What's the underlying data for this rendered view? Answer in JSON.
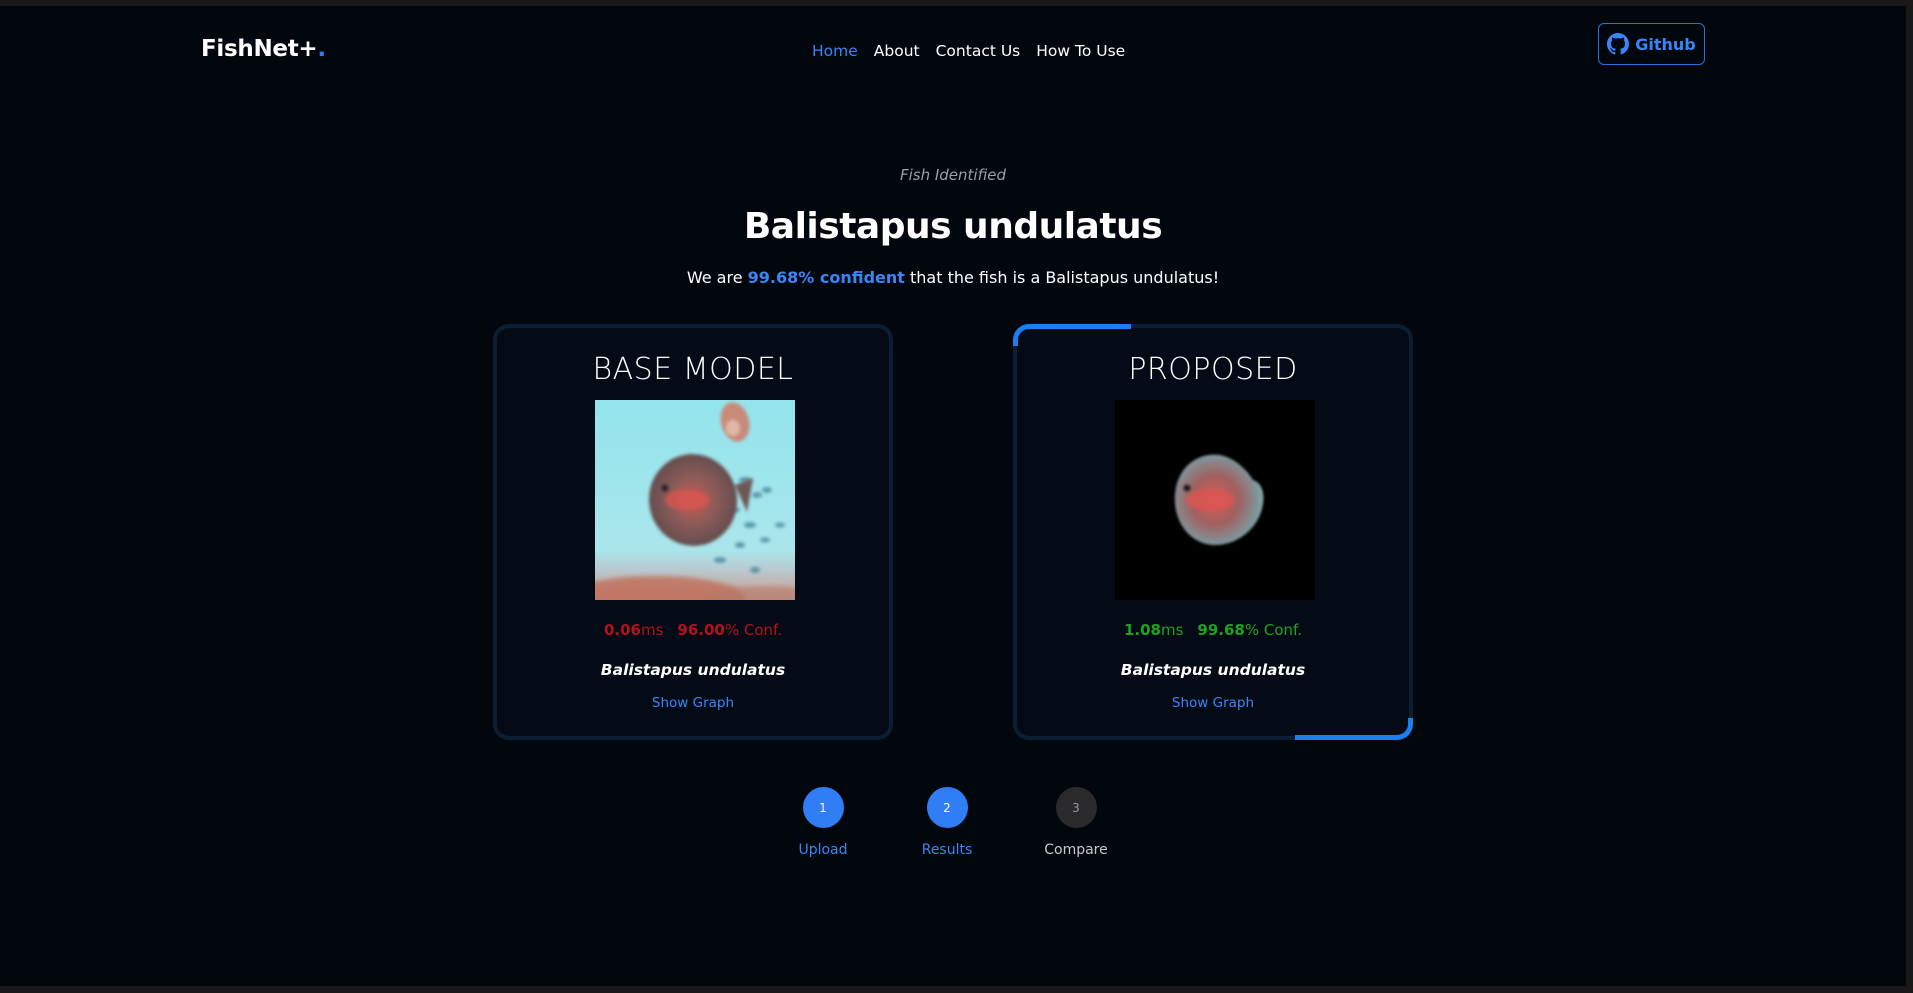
{
  "nav": {
    "logo_text": "FishNet+",
    "logo_dot": ".",
    "links": [
      {
        "label": "Home"
      },
      {
        "label": "About"
      },
      {
        "label": "Contact Us"
      },
      {
        "label": "How To Use"
      }
    ],
    "github_label": "Github"
  },
  "hero": {
    "subtitle": "Fish Identified",
    "title": "Balistapus undulatus",
    "conf_prefix": "We are ",
    "conf_highlight": "99.68% confident",
    "conf_suffix": " that the fish is a Balistapus undulatus!"
  },
  "cards": {
    "base": {
      "title": "BASE MODEL",
      "time_value": "0.06",
      "time_unit": "ms",
      "conf_value": "96.00",
      "conf_unit": "% Conf.",
      "species": "Balistapus undulatus",
      "graph_link": "Show Graph"
    },
    "proposed": {
      "title": "PROPOSED",
      "time_value": "1.08",
      "time_unit": "ms",
      "conf_value": "99.68",
      "conf_unit": "% Conf.",
      "species": "Balistapus undulatus",
      "graph_link": "Show Graph"
    }
  },
  "steps": [
    {
      "number": "1",
      "label": "Upload"
    },
    {
      "number": "2",
      "label": "Results"
    },
    {
      "number": "3",
      "label": "Compare"
    }
  ],
  "colors": {
    "accent": "#2f7ef6",
    "background": "#02060d",
    "base_stats": "#b3121c",
    "proposed_stats": "#1fa31f"
  }
}
